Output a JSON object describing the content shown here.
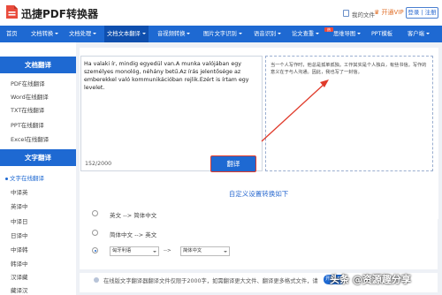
{
  "header": {
    "brand": "迅捷PDF转换器",
    "my_files": "我的文件",
    "vip": "开通VIP",
    "login": "登录 | 注册"
  },
  "nav": {
    "items": [
      "首页",
      "文档转换",
      "文档处理",
      "文档文本翻译",
      "音视频转换",
      "图片文字识别",
      "语音识别",
      "论文查重",
      "思维导图",
      "PPT模板",
      "客户端"
    ],
    "hot_badge": "热"
  },
  "sidebar": {
    "doc_header": "文档翻译",
    "doc_items": [
      "PDF在线翻译",
      "Word在线翻译",
      "TXT在线翻译",
      "PPT在线翻译",
      "Excel在线翻译"
    ],
    "text_header": "文字翻译",
    "text_items": [
      "文字在线翻译",
      "中译英",
      "英译中",
      "中译日",
      "日译中",
      "中译韩",
      "韩译中",
      "汉译藏",
      "藏译汉"
    ]
  },
  "editor": {
    "source_text": "Ha valaki ír, mindig egyedül van.A munka valójában egy személyes monológ, néhány betű.Az írás jelentősége az emberekkel való kommunikációban rejlik.Ezért is írtam egy levelet.",
    "char_count": "152/2000",
    "translate_button": "翻译",
    "result_text": "当一个人写作时，他总是孤单孤独。工作其实是个人独白，有些书信。写作的意义在于与人沟通。因此，我也写了一封信。"
  },
  "settings": {
    "title": "自定义设置转换如下",
    "options": [
      {
        "label": "英文 --> 简体中文",
        "checked": false
      },
      {
        "label": "简体中文 --> 英文",
        "checked": false
      },
      {
        "from": "匈牙利语",
        "arrow": "-->",
        "to": "简体中文",
        "checked": true
      }
    ]
  },
  "notice": {
    "text": "在线版文字翻译器翻译文件仅限于2000字，如需翻译更大文件、翻译更多格式文件，请",
    "vip_button": "开通VIP"
  },
  "watermark": "头条 @资源趣分享",
  "colors": {
    "brand_blue": "#1E69D2",
    "nav_active": "#0F4FAE",
    "annotation_red": "#E03A2A",
    "vip_orange": "#E0702A"
  }
}
